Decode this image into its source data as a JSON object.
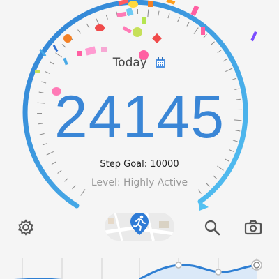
{
  "header": {
    "today_label": "Today",
    "calendar_icon": "calendar-icon"
  },
  "steps": {
    "count": "24145",
    "goal_text": "Step Goal: 10000",
    "level_text": "Level: Highly Active"
  },
  "toolbar": {
    "items": [
      {
        "name": "settings",
        "icon": "gear-icon"
      },
      {
        "name": "map",
        "icon": "running-person-icon"
      },
      {
        "name": "search",
        "icon": "search-icon"
      },
      {
        "name": "camera",
        "icon": "camera-icon"
      }
    ]
  },
  "colors": {
    "accent": "#3a86d6",
    "arc_light": "#4fb8f0",
    "text_muted": "#9a9a9a",
    "background": "#f5f5f5"
  }
}
